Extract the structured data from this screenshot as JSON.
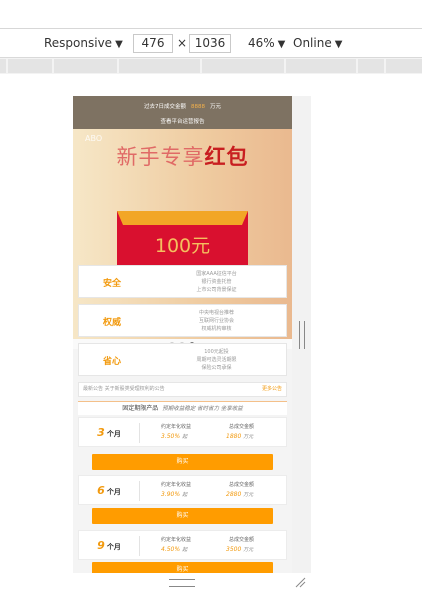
{
  "devtools": {
    "device": "Responsive",
    "width": "476",
    "times": "×",
    "height": "1036",
    "zoom": "46%",
    "network": "Online"
  },
  "page": {
    "topbar": {
      "prefix": "过去7日成交金额",
      "amount": "8888",
      "unit": "万元",
      "link": "查看平台运营报告"
    },
    "banner": {
      "corner": "ABO",
      "title_light": "新手专享",
      "title_strong": "红包",
      "envelope_text": "100元"
    },
    "features": [
      {
        "title": "安全",
        "lines": [
          "国家AAA征信平台",
          "银行资金托管",
          "上市公司背景保证"
        ]
      },
      {
        "title": "权威",
        "lines": [
          "中央电视台推荐",
          "互联网行业协会",
          "权威机构审核"
        ]
      },
      {
        "title": "省心",
        "lines": [
          "100元起投",
          "周期可选灵活期限",
          "保险公司承保"
        ]
      }
    ],
    "notice": {
      "text": "最新公告  关于新股类受理权利的公告",
      "more": "更多公告"
    },
    "fixed_header": {
      "title": "固定期限产品",
      "sub": "预期收益稳定 省时省力 坐享收益"
    },
    "products": [
      {
        "num": "3",
        "unit": "个月",
        "rate_label": "约定年化收益",
        "rate": "3.50%",
        "rate_suffix": "起",
        "amount_label": "总成交金额",
        "amount": "1880",
        "amount_unit": "万元",
        "button": "购买"
      },
      {
        "num": "6",
        "unit": "个月",
        "rate_label": "约定年化收益",
        "rate": "3.90%",
        "rate_suffix": "起",
        "amount_label": "总成交金额",
        "amount": "2880",
        "amount_unit": "万元",
        "button": "购买"
      },
      {
        "num": "9",
        "unit": "个月",
        "rate_label": "约定年化收益",
        "rate": "4.50%",
        "rate_suffix": "起",
        "amount_label": "总成交金额",
        "amount": "3500",
        "amount_unit": "万元",
        "button": "购买"
      }
    ]
  },
  "colors": {
    "accent": "#ff9c00",
    "topbar": "#7e7262",
    "envelope": "#d9102f"
  }
}
